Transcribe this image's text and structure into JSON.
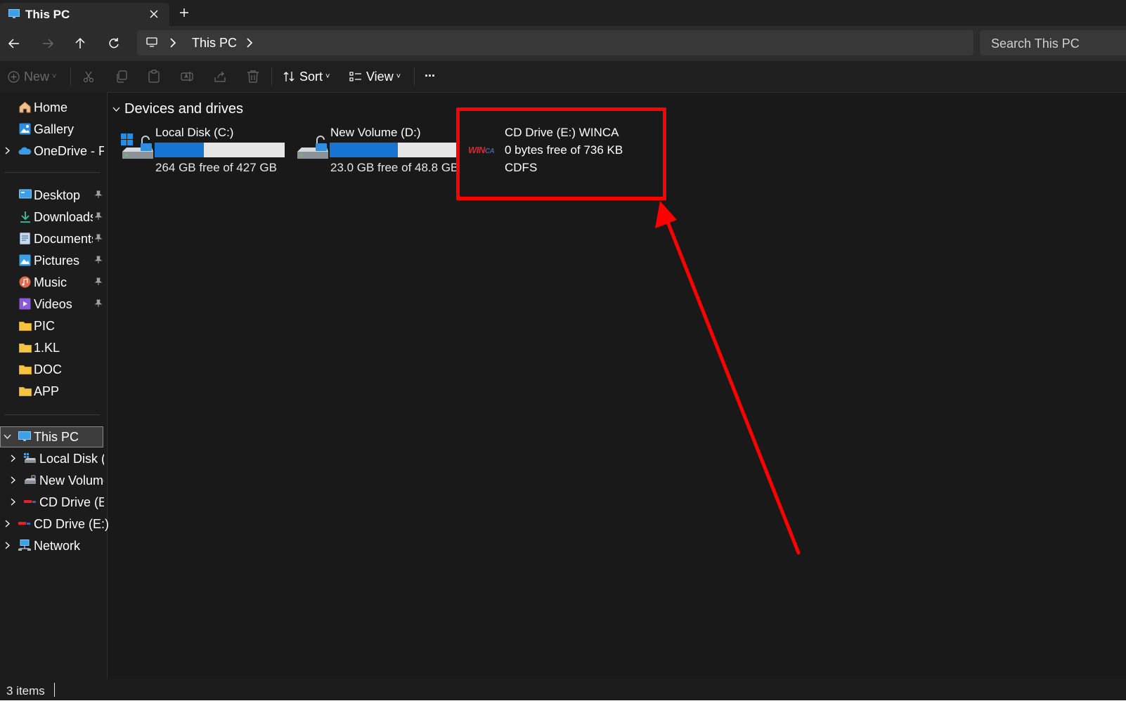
{
  "window": {
    "tab_title": "This PC",
    "tab_icon": "monitor-icon"
  },
  "address": {
    "breadcrumb": "This PC",
    "search_placeholder": "Search This PC"
  },
  "toolbar": {
    "new_label": "New",
    "sort_label": "Sort",
    "view_label": "View",
    "more_label": "..."
  },
  "sidebar": {
    "home": "Home",
    "gallery": "Gallery",
    "onedrive": "OneDrive - P",
    "desktop": "Desktop",
    "downloads": "Downloads",
    "documents": "Documents",
    "pictures": "Pictures",
    "music": "Music",
    "videos": "Videos",
    "pic": "PIC",
    "kl": "1.KL",
    "doc": "DOC",
    "app": "APP",
    "this_pc": "This PC",
    "local_disk": "Local Disk (C:)",
    "new_volume": "New Volume (D:)",
    "cd_drive_child": "CD Drive (E:) WINCA",
    "cd_drive": "CD Drive (E:)",
    "network": "Network"
  },
  "main": {
    "section_title": "Devices and drives",
    "drives": [
      {
        "name": "Local Disk (C:)",
        "size_text": "264 GB free of 427 GB",
        "used_fraction": 0.38
      },
      {
        "name": "New Volume (D:)",
        "size_text": "23.0 GB free of 48.8 GB",
        "used_fraction": 0.53
      }
    ],
    "cd_drive": {
      "name": "CD Drive (E:) WINCA",
      "size_text": "0 bytes free of 736 KB",
      "filesystem": "CDFS",
      "logo_text": "WIN",
      "logo_text_small": "CA"
    }
  },
  "status": {
    "item_count": "3 items"
  },
  "colors": {
    "accent": "#1874d2",
    "annotation": "#ff0000",
    "background": "#191919"
  }
}
